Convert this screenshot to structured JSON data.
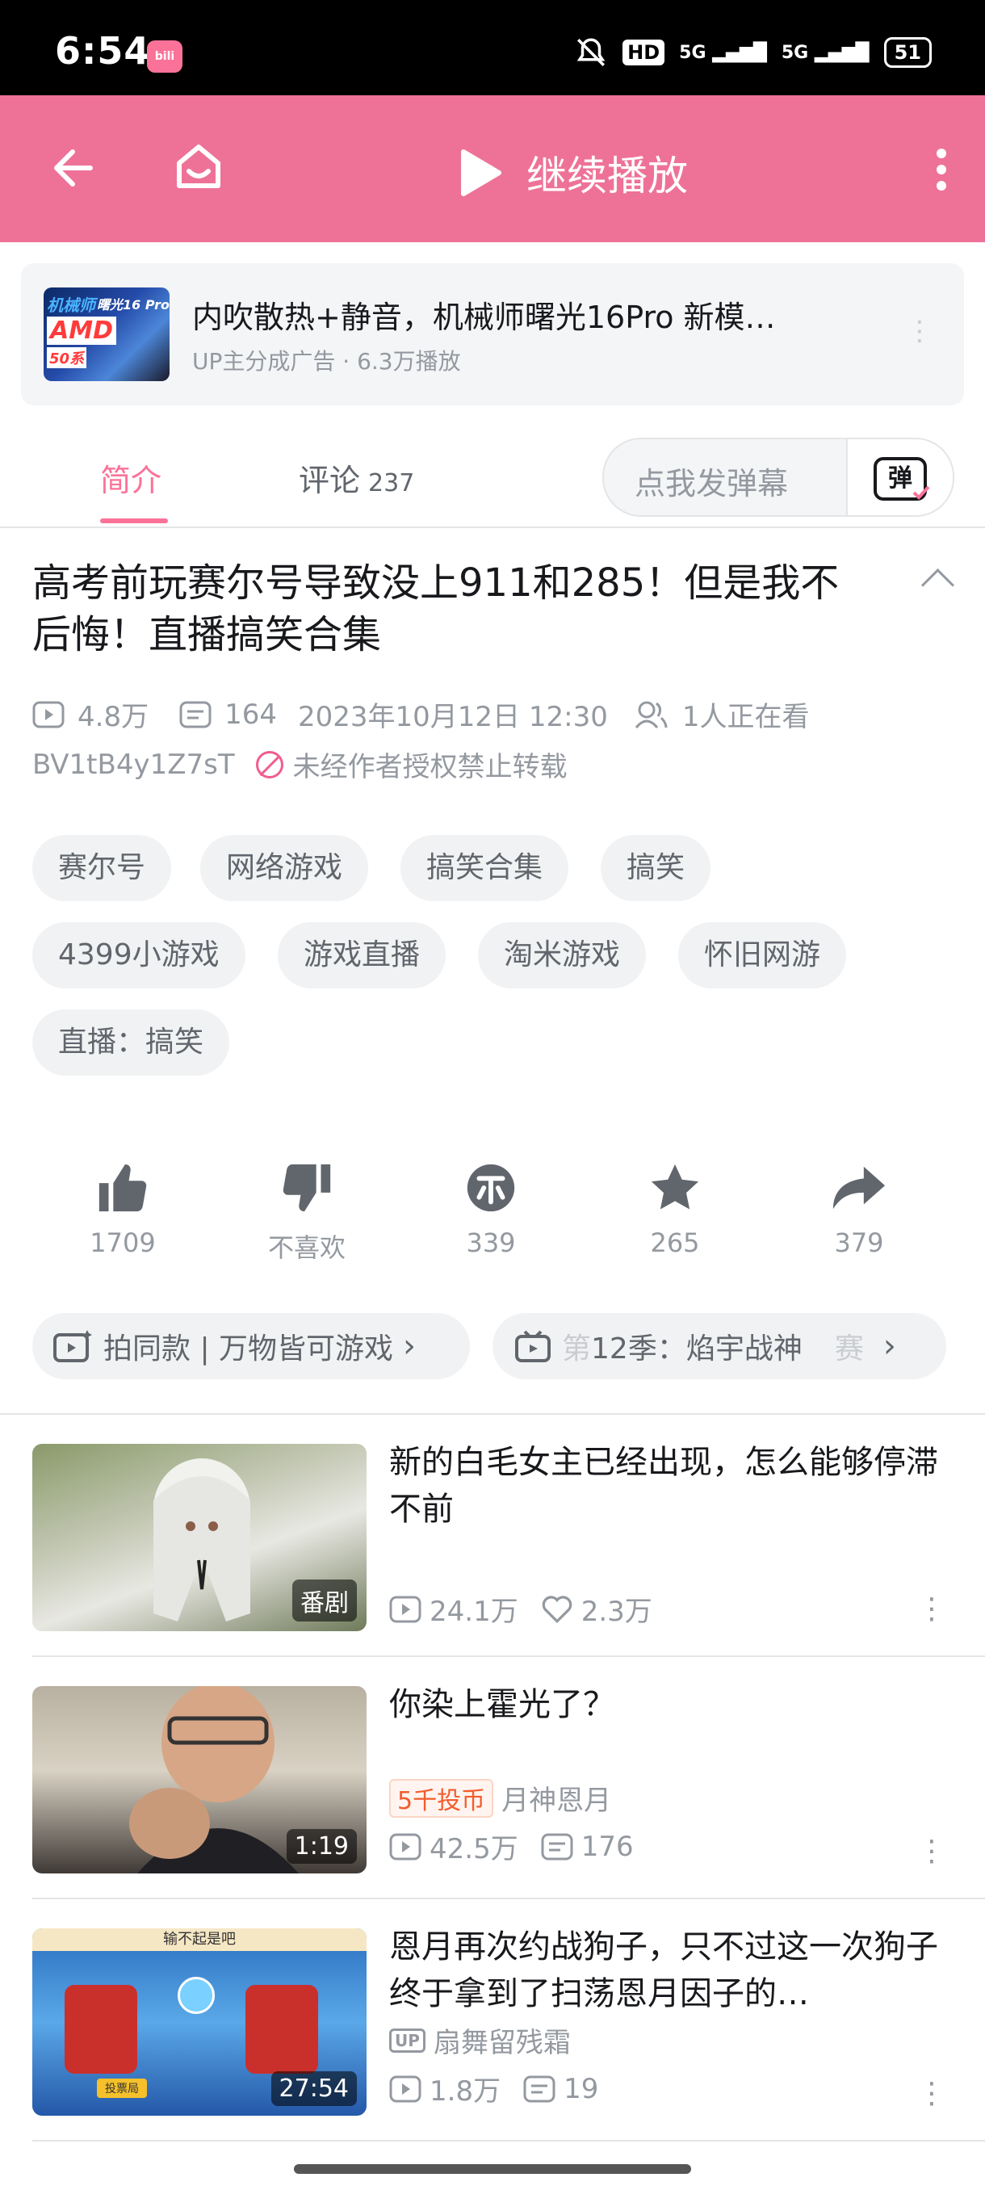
{
  "status_bar": {
    "time": "6:54",
    "app_icon": "bilibili",
    "hd": "HD",
    "signal1": "5G",
    "signal2": "5G",
    "battery": "51"
  },
  "header": {
    "back": "back-icon",
    "home": "home-icon",
    "continue_play": "继续播放",
    "more": "more-icon",
    "bg_color": "#ee7298"
  },
  "ad": {
    "title": "内吹散热+静音，机械师曙光16Pro 新模…",
    "subtitle": "UP主分成广告 · 6.3万播放",
    "thumb_text_1": "机械师",
    "thumb_text_2": "曙光16 Pro",
    "thumb_text_3": "AMD",
    "thumb_text_4": "50系"
  },
  "tabs": {
    "intro": "简介",
    "comments": "评论",
    "comments_count": "237",
    "danmu_placeholder": "点我发弹幕",
    "danmu_btn": "弹"
  },
  "video": {
    "title": "高考前玩赛尔号导致没上911和285！但是我不后悔！直播搞笑合集",
    "views": "4.8万",
    "danmaku": "164",
    "date": "2023年10月12日 12:30",
    "watching": "1人正在看",
    "bvid": "BV1tB4y1Z7sT",
    "notice": "未经作者授权禁止转载"
  },
  "tags": [
    "赛尔号",
    "网络游戏",
    "搞笑合集",
    "搞笑",
    "4399小游戏",
    "游戏直播",
    "淘米游戏",
    "怀旧网游",
    "直播：搞笑"
  ],
  "actions": {
    "like": "1709",
    "dislike": "不喜欢",
    "coin": "339",
    "favorite": "265",
    "share": "379"
  },
  "chips": {
    "chip1": "拍同款 | 万物皆可游戏",
    "chip2_prefix": "第",
    "chip2": "12季：焰宇战神",
    "chip2_suffix": "赛"
  },
  "related": [
    {
      "title": "新的白毛女主已经出现，怎么能够停滞不前",
      "badge": "番剧",
      "views": "24.1万",
      "likes": "2.3万"
    },
    {
      "title": "你染上霍光了？",
      "badge": "1:19",
      "coin_badge": "5千投币",
      "author": "月神恩月",
      "views": "42.5万",
      "danmaku": "176"
    },
    {
      "title": "恩月再次约战狗子，只不过这一次狗子终于拿到了扫荡恩月因子的…",
      "badge": "27:54",
      "author": "扇舞留残霜",
      "views": "1.8万",
      "danmaku": "19",
      "up_label": "UP",
      "thumb_top": "输不起是吧",
      "thumb_btn": "投票局"
    }
  ]
}
